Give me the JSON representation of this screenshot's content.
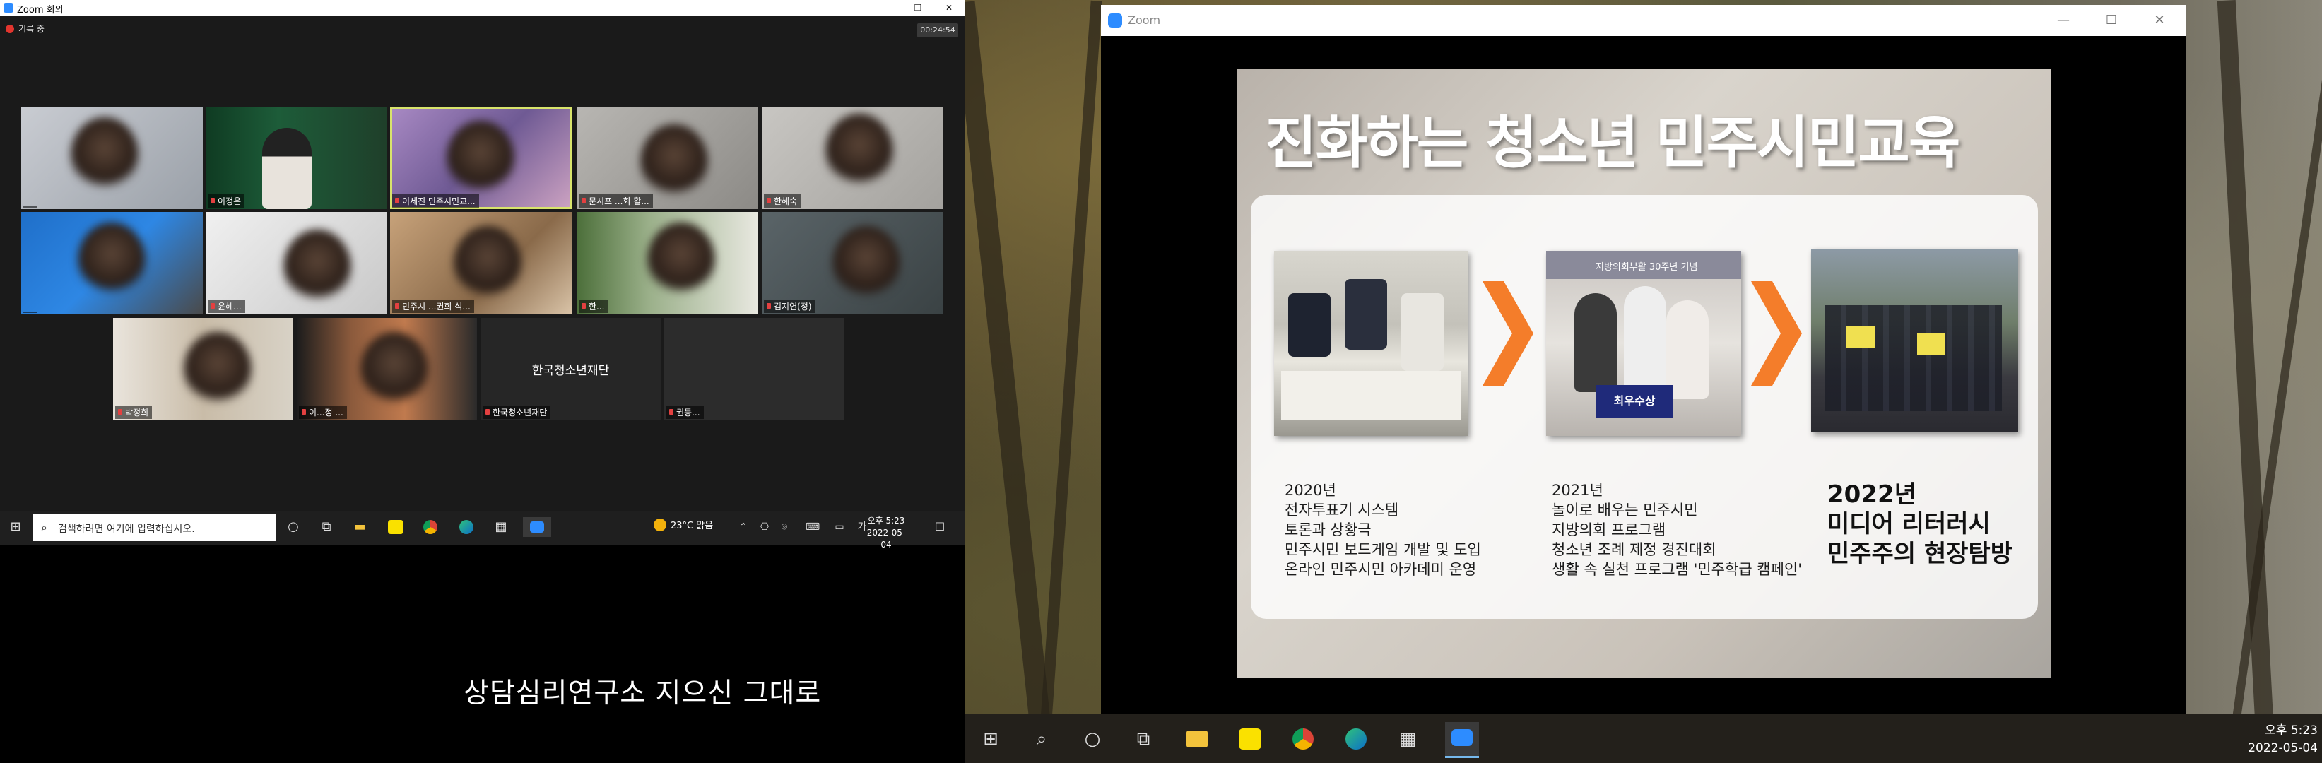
{
  "left_zoom": {
    "title": "Zoom 회의",
    "recording": "기록 중",
    "timer": "00:24:54",
    "window_controls": [
      "—",
      "❐",
      "✕"
    ],
    "tiles": [
      {
        "name": "",
        "type": "blurred"
      },
      {
        "name": "이정은",
        "type": "person"
      },
      {
        "name": "이세진 민주시민교...",
        "type": "active"
      },
      {
        "name": "문시프 ...회 활...",
        "type": "blurred"
      },
      {
        "name": "한혜숙",
        "type": "blurred"
      },
      {
        "name": "",
        "type": "blurred"
      },
      {
        "name": "윤혜...",
        "type": "blurred"
      },
      {
        "name": "민주시 ...권회 식...",
        "type": "blurred"
      },
      {
        "name": "한...",
        "type": "blurred"
      },
      {
        "name": "김지연(정)",
        "type": "blurred"
      },
      {
        "name": "박정희",
        "type": "blurred"
      },
      {
        "name": "이...정 ...",
        "type": "blurred"
      },
      {
        "name": "한국청소년재단",
        "type": "text",
        "center_label": "한국청소년재단"
      },
      {
        "name": "권동...",
        "type": "dark"
      }
    ]
  },
  "left_taskbar": {
    "search_placeholder": "검색하려면 여기에 입력하십시오.",
    "weather": "23°C 맑음",
    "time": "오후 5:23",
    "date": "2022-05-04",
    "ime": "가"
  },
  "caption": "상담심리연구소 지으신 그대로",
  "right_zoom": {
    "title": "Zoom",
    "window_controls": [
      "—",
      "☐",
      "✕"
    ]
  },
  "slide": {
    "title": "진화하는 청소년 민주시민교육",
    "columns": [
      {
        "lines": [
          "2020년",
          "전자투표기 시스템",
          "토론과 상황극",
          "민주시민 보드게임 개발 및 도입",
          "온라인 민주시민 아카데미 운영"
        ]
      },
      {
        "lines": [
          "2021년",
          "놀이로 배우는 민주시민",
          "지방의회 프로그램",
          "청소년 조례 제정 경진대회",
          "생활 속 실천 프로그램 '민주학급 캠페인'"
        ]
      },
      {
        "lines": [
          "2022년",
          "미디어 리터러시",
          "민주주의 현장탐방"
        ]
      }
    ],
    "photo2_sign": "최우수상",
    "photo2_banner": "지방의회부활 30주년 기념",
    "accent_color": "#f47d2a"
  },
  "right_taskbar": {
    "time": "오후 5:23",
    "date": "2022-05-04",
    "apps": [
      "windows",
      "search",
      "cortana",
      "task-view",
      "file-explorer",
      "kakaotalk",
      "chrome",
      "edge",
      "app",
      "zoom"
    ]
  }
}
